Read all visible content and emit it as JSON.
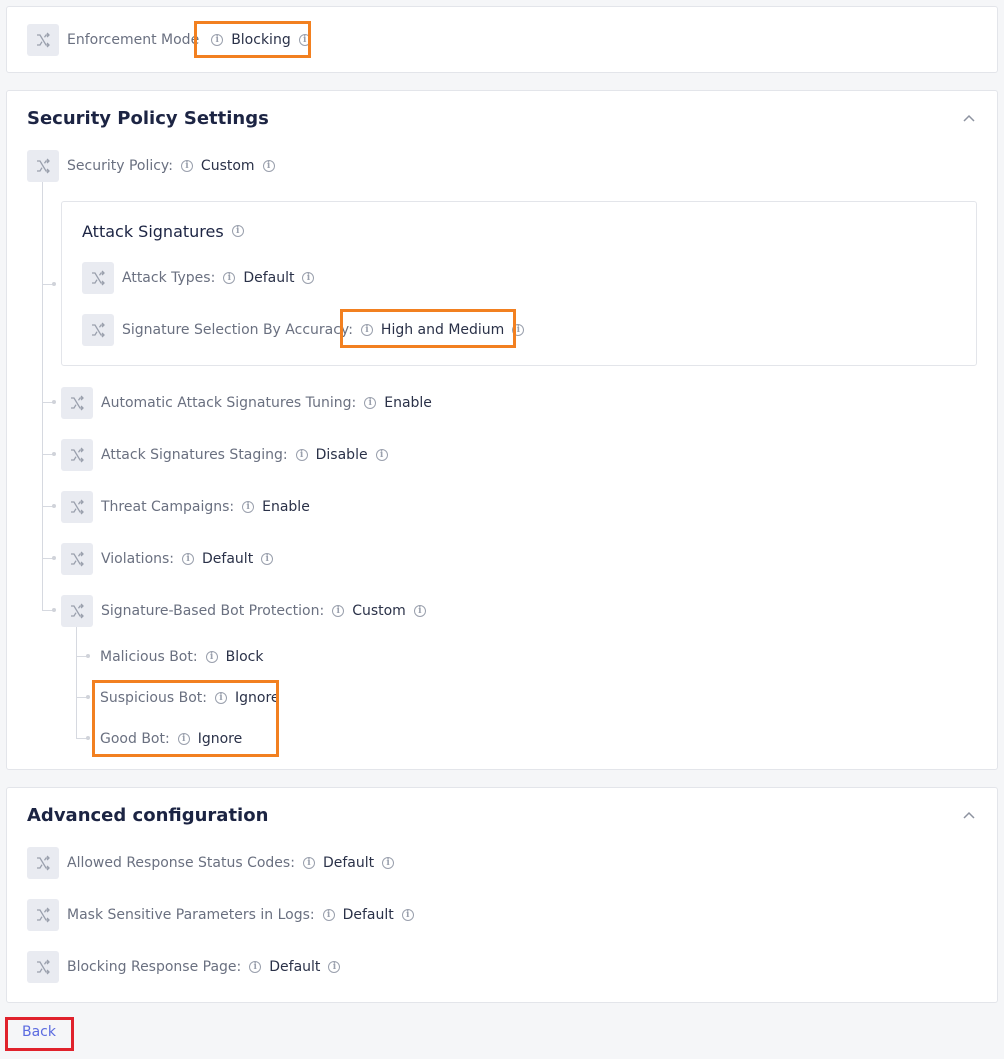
{
  "enforcement": {
    "label": "Enforcement Mode",
    "value": "Blocking"
  },
  "security": {
    "title": "Security Policy Settings",
    "policy": {
      "label": "Security Policy:",
      "value": "Custom"
    },
    "attack_signatures": {
      "title": "Attack Signatures",
      "attack_types": {
        "label": "Attack Types:",
        "value": "Default"
      },
      "accuracy": {
        "label": "Signature Selection By Accuracy:",
        "value": "High and Medium"
      }
    },
    "tuning": {
      "label": "Automatic Attack Signatures Tuning:",
      "value": "Enable"
    },
    "staging": {
      "label": "Attack Signatures Staging:",
      "value": "Disable"
    },
    "campaigns": {
      "label": "Threat Campaigns:",
      "value": "Enable"
    },
    "violations": {
      "label": "Violations:",
      "value": "Default"
    },
    "bot": {
      "label": "Signature-Based Bot Protection:",
      "value": "Custom"
    },
    "malicious": {
      "label": "Malicious Bot:",
      "value": "Block"
    },
    "suspicious": {
      "label": "Suspicious Bot:",
      "value": "Ignore"
    },
    "good": {
      "label": "Good Bot:",
      "value": "Ignore"
    }
  },
  "advanced": {
    "title": "Advanced configuration",
    "status_codes": {
      "label": "Allowed Response Status Codes:",
      "value": "Default"
    },
    "mask": {
      "label": "Mask Sensitive Parameters in Logs:",
      "value": "Default"
    },
    "blocking_page": {
      "label": "Blocking Response Page:",
      "value": "Default"
    }
  },
  "back_label": "Back",
  "icons": {
    "node": "branch-icon",
    "info": "info-icon",
    "collapse": "chevron-up-icon"
  },
  "colors": {
    "highlight_orange": "#f28020",
    "highlight_red": "#e0222c",
    "link": "#5b6be0"
  }
}
